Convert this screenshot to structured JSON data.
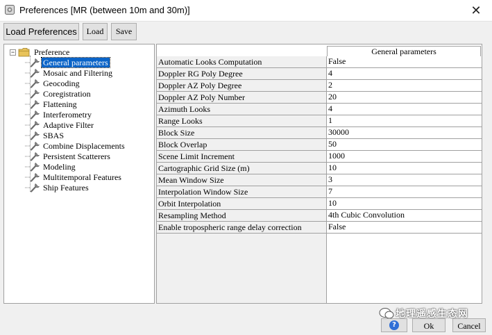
{
  "window": {
    "title": "Preferences [MR (between 10m and 30m)]",
    "close_glyph": "✕"
  },
  "toolbar": {
    "load_preferences": "Load Preferences",
    "load": "Load",
    "save": "Save"
  },
  "tree": {
    "root": "Preference",
    "expander_glyph": "−",
    "items": [
      "General parameters",
      "Mosaic and Filtering",
      "Geocoding",
      "Coregistration",
      "Flattening",
      "Interferometry",
      "Adaptive Filter",
      "SBAS",
      "Combine Displacements",
      "Persistent Scatterers",
      "Modeling",
      "Multitemporal Features",
      "Ship Features"
    ],
    "selected_index": 0
  },
  "grid": {
    "header": "General parameters",
    "rows": [
      {
        "name": "Automatic Looks Computation",
        "value": "False"
      },
      {
        "name": "Doppler RG Poly Degree",
        "value": "4"
      },
      {
        "name": "Doppler AZ Poly Degree",
        "value": "2"
      },
      {
        "name": "Doppler AZ Poly Number",
        "value": "20"
      },
      {
        "name": "Azimuth Looks",
        "value": "4"
      },
      {
        "name": "Range Looks",
        "value": "1"
      },
      {
        "name": "Block Size",
        "value": "30000"
      },
      {
        "name": "Block Overlap",
        "value": "50"
      },
      {
        "name": "Scene Limit Increment",
        "value": "1000"
      },
      {
        "name": "Cartographic Grid Size (m)",
        "value": "10"
      },
      {
        "name": "Mean Window Size",
        "value": "3"
      },
      {
        "name": "Interpolation Window Size",
        "value": "7"
      },
      {
        "name": "Orbit Interpolation",
        "value": "10"
      },
      {
        "name": "Resampling Method",
        "value": "4th Cubic Convolution"
      },
      {
        "name": "Enable tropospheric range delay correction",
        "value": "False"
      }
    ]
  },
  "watermark": "地理遥感生态网",
  "footer": {
    "help_glyph": "?",
    "ok": "Ok",
    "cancel": "Cancel"
  },
  "colors": {
    "selection": "#0a64c8",
    "folder": "#e8c35a",
    "help": "#2f6fd6"
  },
  "icons": {
    "tree_item": "wrench-icon",
    "tree_root": "folder-icon",
    "app": "app-icon"
  }
}
